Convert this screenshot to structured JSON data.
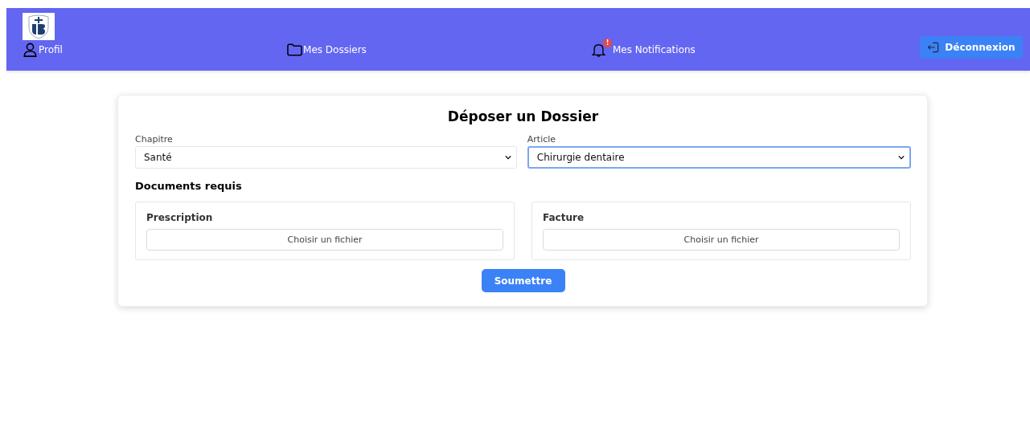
{
  "navbar": {
    "items": [
      {
        "kind": "profile",
        "label": "Profil"
      },
      {
        "kind": "folder",
        "label": "Mes Dossiers"
      },
      {
        "kind": "bell",
        "label": "Mes Notifications",
        "badge": "!"
      }
    ],
    "logout": "Déconnexion"
  },
  "form": {
    "title": "Déposer un Dossier",
    "selects": [
      {
        "label": "Chapitre",
        "value": "Santé",
        "focused": false
      },
      {
        "label": "Article",
        "value": "Chirurgie dentaire",
        "focused": true
      }
    ],
    "documents_title": "Documents requis",
    "documents": [
      {
        "label": "Prescription",
        "button": "Choisir un fichier"
      },
      {
        "label": "Facture",
        "button": "Choisir un fichier"
      }
    ],
    "submit": "Soumettre"
  }
}
